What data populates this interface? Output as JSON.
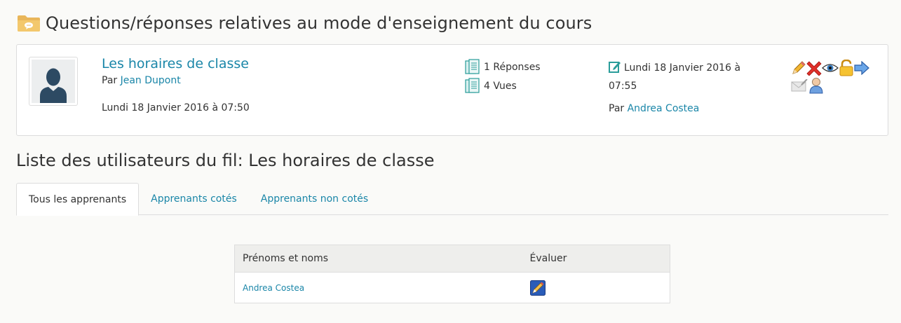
{
  "page": {
    "title": "Questions/réponses relatives au mode d'enseignement du cours",
    "title_icon": "folder-icon"
  },
  "thread": {
    "title": "Les horaires de classe",
    "author_prefix": "Par",
    "author": "Jean Dupont",
    "date": "Lundi 18 Janvier 2016 à 07:50",
    "replies": "1 Réponses",
    "views": "4 Vues",
    "last_post_date_line1": "Lundi 18 Janvier 2016 à",
    "last_post_date_line2": "07:55",
    "last_post_by_prefix": "Par",
    "last_post_by": "Andrea Costea",
    "actions": [
      "edit-icon",
      "delete-icon",
      "visibility-icon",
      "lock-icon",
      "move-icon",
      "email-icon",
      "user-icon"
    ]
  },
  "section": {
    "title": "Liste des utilisateurs du fil: Les horaires de classe"
  },
  "tabs": [
    {
      "label": "Tous les apprenants",
      "active": true
    },
    {
      "label": "Apprenants cotés",
      "active": false
    },
    {
      "label": "Apprenants non cotés",
      "active": false
    }
  ],
  "table": {
    "headers": [
      "Prénoms et noms",
      "Évaluer"
    ],
    "rows": [
      {
        "name": "Andrea Costea",
        "evaluate_icon": "grade-icon"
      }
    ]
  },
  "colors": {
    "link": "#1a86a8",
    "accent_teal": "#2a9d9a"
  }
}
